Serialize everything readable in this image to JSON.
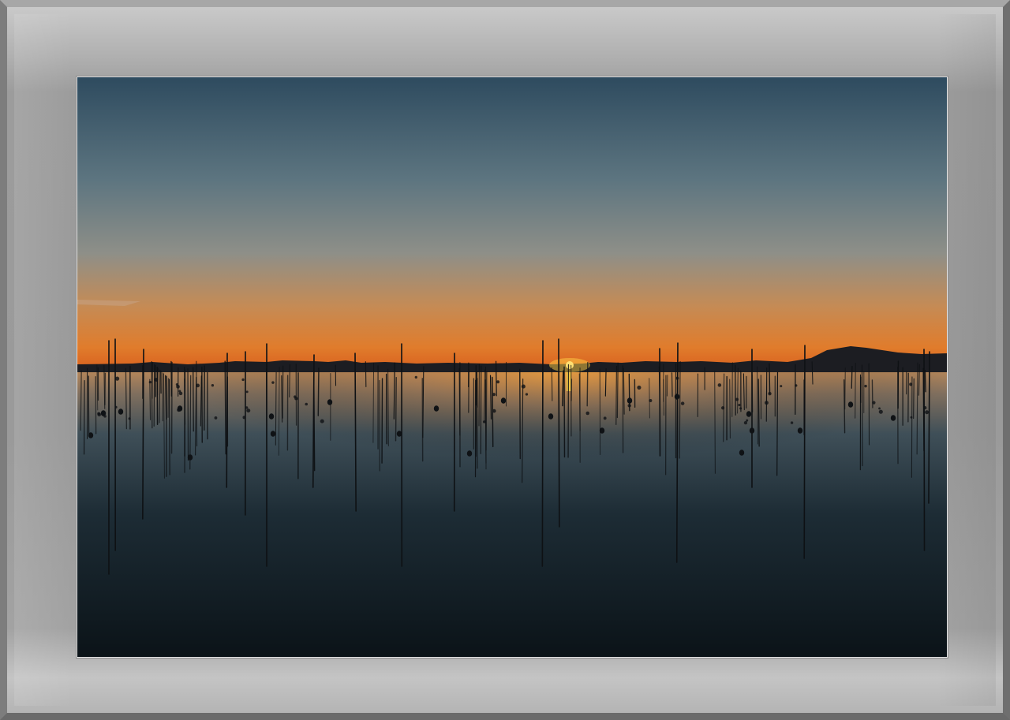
{
  "frame": {
    "mat_color": "#9c9c9c",
    "edge_color": "#7d7d7d"
  },
  "photo": {
    "subject": "sunset-over-calm-water",
    "colors": {
      "sky_top": "#2f4c5e",
      "sky_mid": "#7f8f90",
      "horizon_glow": "#f59a1f",
      "sun": "#ffd23a",
      "water_dark": "#0c1419"
    }
  }
}
